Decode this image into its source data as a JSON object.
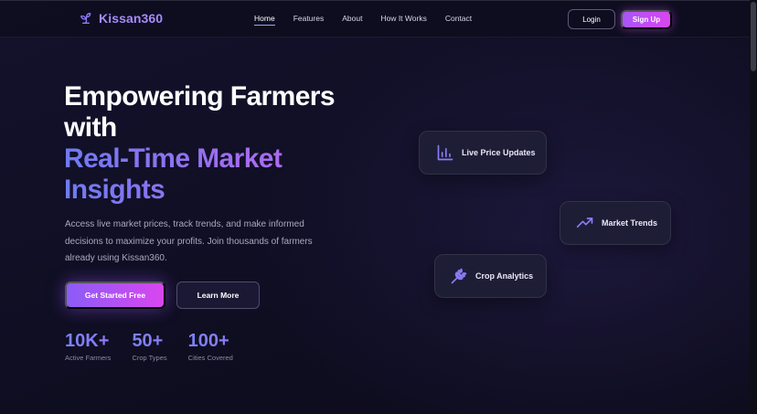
{
  "brand": {
    "name": "Kissan360",
    "icon": "sprout-icon"
  },
  "nav": {
    "links": [
      "Home",
      "Features",
      "About",
      "How It Works",
      "Contact"
    ],
    "active": "Home",
    "login_label": "Login",
    "signup_label": "Sign Up"
  },
  "hero": {
    "headline_line1": "Empowering Farmers",
    "headline_line2": "with",
    "headline_highlight1": "Real-Time Market",
    "headline_highlight2": "Insights",
    "subtext": "Access live market prices, track trends, and make informed decisions to maximize your profits. Join thousands of farmers already using Kissan360.",
    "primary_cta": "Get Started Free",
    "secondary_cta": "Learn More"
  },
  "stats": [
    {
      "value": "10K+",
      "label": "Active Farmers"
    },
    {
      "value": "50+",
      "label": "Crop Types"
    },
    {
      "value": "100+",
      "label": "Cities Covered"
    }
  ],
  "feature_cards": [
    {
      "label": "Live Price Updates",
      "icon": "bar-chart-icon"
    },
    {
      "label": "Market Trends",
      "icon": "trending-up-icon"
    },
    {
      "label": "Crop Analytics",
      "icon": "wheat-icon"
    }
  ],
  "colors": {
    "background": "#0d0c1d",
    "accent_purple": "#a855f7",
    "accent_pink": "#d946ef",
    "accent_indigo": "#6e7bf2",
    "card_bg": "#1e1e36"
  }
}
